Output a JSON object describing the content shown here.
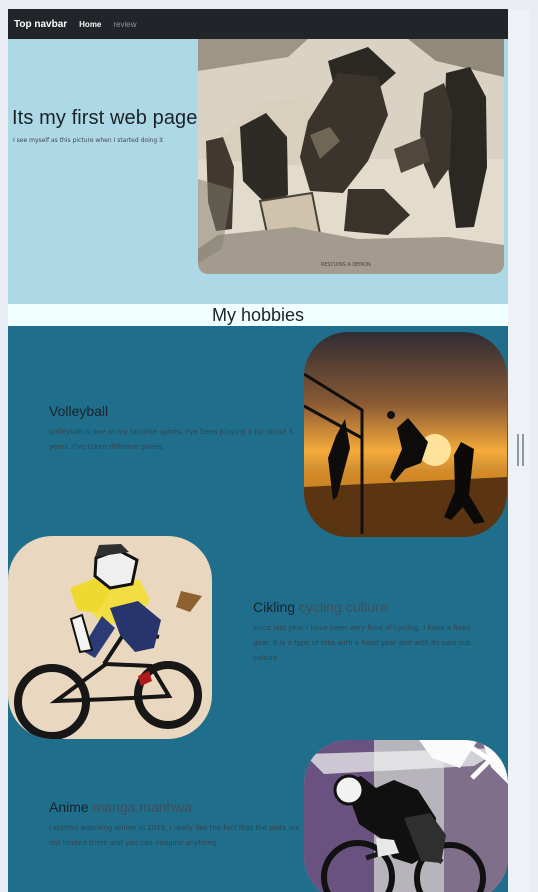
{
  "navbar": {
    "brand": "Top navbar",
    "links": [
      {
        "label": "Home"
      },
      {
        "label": "review"
      }
    ]
  },
  "hero": {
    "title": "Its my first web page",
    "subtitle": "I see myself as this picture when I started doing it",
    "caption": "RESCUING A DEMON."
  },
  "section": {
    "title": "My hobbies"
  },
  "hobbies": [
    {
      "title": "Volleyball",
      "title_extra": "",
      "text": "Volleyball is one of my favorite sports. I've been playing it for about 3 years. I've taken different prizes."
    },
    {
      "title": "Cikling",
      "title_extra": "cycling culture",
      "text": "since last year I have been very fond of cycling. I have a fixed gear. It is a type of bike with a fixed gear and with its own sub culture"
    },
    {
      "title": "Anime",
      "title_extra": "manga,manhwa",
      "text": "I started watching anime in 2018, I really like the fact that the plots are not limited there and you can imagine anything."
    }
  ],
  "colors": {
    "navbar": "#212529",
    "hero_bg": "#add8e6",
    "section_bg": "#1f6e8c",
    "hobbies_band": "#f0ffff"
  }
}
